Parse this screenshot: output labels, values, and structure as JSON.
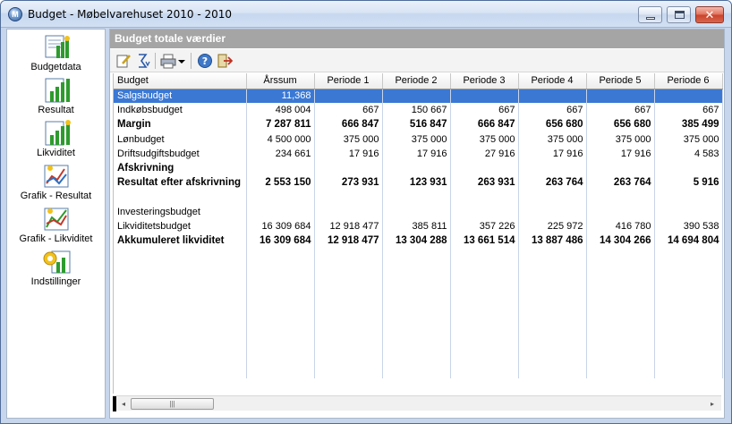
{
  "window": {
    "title": "Budget - Møbelvarehuset 2010 - 2010",
    "app_icon_letter": "M",
    "close_glyph": "✕"
  },
  "sidebar": {
    "items": [
      {
        "label": "Budgetdata",
        "icon": "budgetdata-icon"
      },
      {
        "label": "Resultat",
        "icon": "resultat-chart-icon"
      },
      {
        "label": "Likviditet",
        "icon": "likviditet-chart-icon"
      },
      {
        "label": "Grafik - Resultat",
        "icon": "graph-resultat-icon"
      },
      {
        "label": "Grafik - Likviditet",
        "icon": "graph-likviditet-icon"
      },
      {
        "label": "Indstillinger",
        "icon": "settings-icon"
      }
    ]
  },
  "panel": {
    "title": "Budget totale værdier"
  },
  "toolbar": {
    "icons": [
      "edit-icon",
      "sort-icon",
      "print-icon",
      "dropdown-arrow-icon",
      "help-icon",
      "exit-icon"
    ]
  },
  "table": {
    "columns": [
      "Budget",
      "Årssum",
      "Periode 1",
      "Periode 2",
      "Periode 3",
      "Periode 4",
      "Periode 5",
      "Periode 6"
    ],
    "rows": [
      {
        "label": "Salgsbudget",
        "values": [
          "11,368",
          "",
          "",
          "",
          "",
          "",
          ""
        ],
        "style": "selected"
      },
      {
        "label": "Indkøbsbudget",
        "values": [
          "498 004",
          "667",
          "150 667",
          "667",
          "667",
          "667",
          "667"
        ],
        "style": "normal"
      },
      {
        "label": "Margin",
        "values": [
          "7 287 811",
          "666 847",
          "516 847",
          "666 847",
          "656 680",
          "656 680",
          "385 499"
        ],
        "style": "bold"
      },
      {
        "label": "Lønbudget",
        "values": [
          "4 500 000",
          "375 000",
          "375 000",
          "375 000",
          "375 000",
          "375 000",
          "375 000"
        ],
        "style": "normal"
      },
      {
        "label": "Driftsudgiftsbudget",
        "values": [
          "234 661",
          "17 916",
          "17 916",
          "27 916",
          "17 916",
          "17 916",
          "4 583"
        ],
        "style": "normal"
      },
      {
        "label": "Afskrivning",
        "values": [
          "",
          "",
          "",
          "",
          "",
          "",
          ""
        ],
        "style": "bold"
      },
      {
        "label": "Resultat efter afskrivning",
        "values": [
          "2 553 150",
          "273 931",
          "123 931",
          "263 931",
          "263 764",
          "263 764",
          "5 916"
        ],
        "style": "bold"
      },
      {
        "label": "",
        "values": [
          "",
          "",
          "",
          "",
          "",
          "",
          ""
        ],
        "style": "normal"
      },
      {
        "label": "Investeringsbudget",
        "values": [
          "",
          "",
          "",
          "",
          "",
          "",
          ""
        ],
        "style": "normal"
      },
      {
        "label": "Likviditetsbudget",
        "values": [
          "16 309 684",
          "12 918 477",
          "385 811",
          "357 226",
          "225 972",
          "416 780",
          "390 538"
        ],
        "style": "normal"
      },
      {
        "label": "Akkumuleret likviditet",
        "values": [
          "16 309 684",
          "12 918 477",
          "13 304 288",
          "13 661 514",
          "13 887 486",
          "14 304 266",
          "14 694 804"
        ],
        "style": "bold"
      }
    ],
    "empty_rows": 9
  },
  "scrollbar": {
    "left_arrow": "◂",
    "right_arrow": "▸",
    "thumb_grip": "|||"
  },
  "colors": {
    "selection": "#3a78d4",
    "panel_header": "#a5a5a5"
  }
}
